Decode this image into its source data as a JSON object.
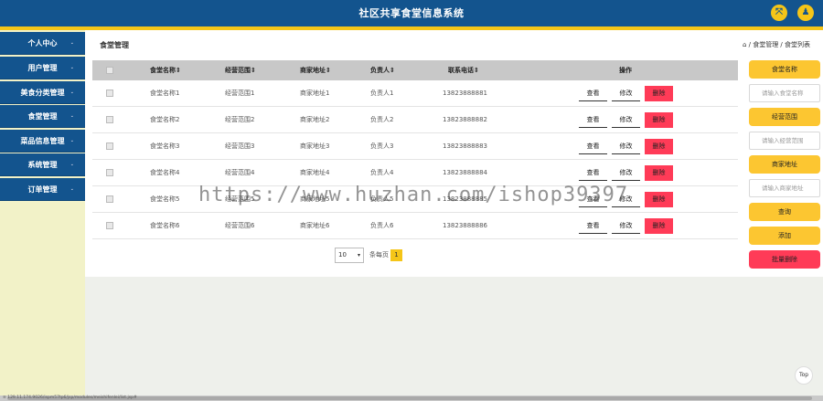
{
  "header": {
    "title": "社区共享食堂信息系统",
    "icon_left": "⤧",
    "icon_right": "♟"
  },
  "sidebar": {
    "items": [
      "个人中心",
      "用户管理",
      "美食分类管理",
      "食堂管理",
      "菜品信息管理",
      "系统管理",
      "订单管理"
    ]
  },
  "page": {
    "title": "食堂管理",
    "breadcrumb": "⌂ / 食堂管理 / 食堂列表"
  },
  "table": {
    "columns": [
      "食堂名称⇕",
      "经营范围⇕",
      "商家地址⇕",
      "负责人⇕",
      "联系电话⇕",
      "操作"
    ],
    "rows": [
      [
        "食堂名称1",
        "经营范围1",
        "商家地址1",
        "负责人1",
        "13823888881"
      ],
      [
        "食堂名称2",
        "经营范围2",
        "商家地址2",
        "负责人2",
        "13823888882"
      ],
      [
        "食堂名称3",
        "经营范围3",
        "商家地址3",
        "负责人3",
        "13823888883"
      ],
      [
        "食堂名称4",
        "经营范围4",
        "商家地址4",
        "负责人4",
        "13823888884"
      ],
      [
        "食堂名称5",
        "经营范围5",
        "商家地址5",
        "负责人5",
        "13823888885"
      ],
      [
        "食堂名称6",
        "经营范围6",
        "商家地址6",
        "负责人6",
        "13823888886"
      ]
    ],
    "actions": {
      "view": "查看",
      "edit": "修改",
      "delete": "删除"
    }
  },
  "pager": {
    "page_size": "10",
    "per_page_label": "条每页",
    "current_page": "1"
  },
  "search": {
    "name_label": "食堂名称",
    "name_placeholder": "请输入食堂名称",
    "scope_label": "经营范围",
    "scope_placeholder": "请输入经营范围",
    "address_label": "商家地址",
    "address_placeholder": "请输入商家地址",
    "query": "查询",
    "add": "添加",
    "batch_delete": "批量删除"
  },
  "top_button": "Top",
  "statusbar_url": "≡ 129.11.174.9026/ispm57tp6/jsp/modules/meishifenlei/list.jsp#",
  "watermark": "https://www.huzhan.com/ishop39397",
  "colors": {
    "header": "#13548e",
    "accent": "#f5c518",
    "danger": "#ff3b57",
    "sidebar_bg": "#f2f2c8"
  }
}
